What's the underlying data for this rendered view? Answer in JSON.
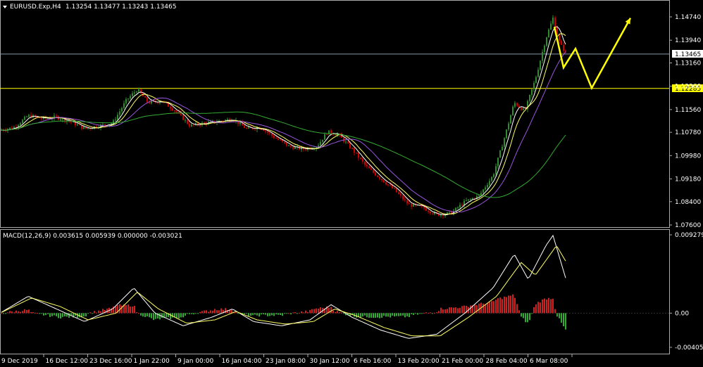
{
  "header": {
    "symbol": "EURUSD.Exp,H4",
    "ohlc": "1.13254 1.13477 1.13243 1.13465"
  },
  "macd": {
    "label": "MACD(12,26,9) 0.003615 0.005939 0.000000 -0.003021"
  },
  "price_axis": [
    "1.14740",
    "1.13940",
    "1.13160",
    "1.12360",
    "1.11560",
    "1.10780",
    "1.09980",
    "1.09180",
    "1.08400",
    "1.07600"
  ],
  "price_tags": {
    "current": "1.13465",
    "level": "1.12285"
  },
  "macd_axis": [
    "0.009279",
    "0.00",
    "-0.004053"
  ],
  "time_axis": [
    "9 Dec 2019",
    "16 Dec 12:00",
    "23 Dec 16:00",
    "1 Jan 22:00",
    "9 Jan 00:00",
    "16 Jan 04:00",
    "23 Jan 08:00",
    "30 Jan 12:00",
    "6 Feb 16:00",
    "13 Feb 20:00",
    "21 Feb 00:00",
    "28 Feb 04:00",
    "6 Mar 08:00"
  ],
  "colors": {
    "background": "#000000",
    "bull": "#2e8b2e",
    "bear": "#cc0000",
    "ma_fast": "#ffffff",
    "ma_mid": "#ffff66",
    "ma_slow": "#9955dd",
    "ma_long": "#33aa33",
    "hist_pos": "#cc2222",
    "hist_neg": "#33aa33",
    "arrow": "#ffff00",
    "level_line": "#ffff00"
  },
  "chart_data": {
    "type": "candlestick",
    "price_path": [
      [
        0,
        1.1085
      ],
      [
        20,
        1.1095
      ],
      [
        40,
        1.1135
      ],
      [
        60,
        1.1125
      ],
      [
        80,
        1.113
      ],
      [
        100,
        1.1115
      ],
      [
        120,
        1.109
      ],
      [
        140,
        1.11
      ],
      [
        160,
        1.111
      ],
      [
        180,
        1.119
      ],
      [
        195,
        1.1225
      ],
      [
        210,
        1.118
      ],
      [
        230,
        1.1185
      ],
      [
        250,
        1.115
      ],
      [
        270,
        1.11
      ],
      [
        290,
        1.111
      ],
      [
        310,
        1.1115
      ],
      [
        330,
        1.1125
      ],
      [
        350,
        1.109
      ],
      [
        370,
        1.1095
      ],
      [
        390,
        1.106
      ],
      [
        410,
        1.103
      ],
      [
        430,
        1.102
      ],
      [
        450,
        1.103
      ],
      [
        465,
        1.108
      ],
      [
        480,
        1.107
      ],
      [
        500,
        1.102
      ],
      [
        520,
        1.096
      ],
      [
        540,
        1.092
      ],
      [
        560,
        1.088
      ],
      [
        580,
        1.083
      ],
      [
        600,
        1.082
      ],
      [
        620,
        1.0795
      ],
      [
        640,
        1.08
      ],
      [
        660,
        1.084
      ],
      [
        680,
        1.086
      ],
      [
        700,
        1.093
      ],
      [
        715,
        1.105
      ],
      [
        730,
        1.118
      ],
      [
        745,
        1.115
      ],
      [
        760,
        1.126
      ],
      [
        775,
        1.14
      ],
      [
        785,
        1.147
      ],
      [
        795,
        1.138
      ],
      [
        805,
        1.1346
      ]
    ],
    "forecast_arrow": [
      [
        787,
        1.144
      ],
      [
        800,
        1.13
      ],
      [
        817,
        1.1365
      ],
      [
        840,
        1.123
      ],
      [
        895,
        1.147
      ]
    ],
    "levels": [
      1.13465,
      1.12285
    ],
    "macd_main": [
      [
        0,
        0.0
      ],
      [
        40,
        0.002
      ],
      [
        80,
        0.0005
      ],
      [
        120,
        -0.001
      ],
      [
        160,
        0.0005
      ],
      [
        190,
        0.003
      ],
      [
        220,
        0.0
      ],
      [
        260,
        -0.0015
      ],
      [
        300,
        -0.0005
      ],
      [
        330,
        0.0005
      ],
      [
        360,
        -0.001
      ],
      [
        400,
        -0.0015
      ],
      [
        440,
        -0.0008
      ],
      [
        470,
        0.001
      ],
      [
        500,
        -0.0005
      ],
      [
        540,
        -0.002
      ],
      [
        580,
        -0.003
      ],
      [
        620,
        -0.0025
      ],
      [
        660,
        0.0
      ],
      [
        700,
        0.003
      ],
      [
        730,
        0.007
      ],
      [
        750,
        0.004
      ],
      [
        775,
        0.008
      ],
      [
        785,
        0.0092
      ],
      [
        805,
        0.0036
      ]
    ],
    "macd_signal": [
      [
        0,
        0.0
      ],
      [
        45,
        0.0018
      ],
      [
        85,
        0.0008
      ],
      [
        125,
        -0.0008
      ],
      [
        165,
        0.0
      ],
      [
        195,
        0.0025
      ],
      [
        225,
        0.0005
      ],
      [
        265,
        -0.0012
      ],
      [
        305,
        -0.0008
      ],
      [
        335,
        0.0002
      ],
      [
        365,
        -0.0008
      ],
      [
        405,
        -0.0013
      ],
      [
        445,
        -0.001
      ],
      [
        475,
        0.0005
      ],
      [
        505,
        -0.0003
      ],
      [
        545,
        -0.0017
      ],
      [
        585,
        -0.0027
      ],
      [
        625,
        -0.0027
      ],
      [
        665,
        -0.0005
      ],
      [
        705,
        0.002
      ],
      [
        740,
        0.006
      ],
      [
        760,
        0.0045
      ],
      [
        790,
        0.008
      ],
      [
        805,
        0.0059
      ]
    ]
  }
}
